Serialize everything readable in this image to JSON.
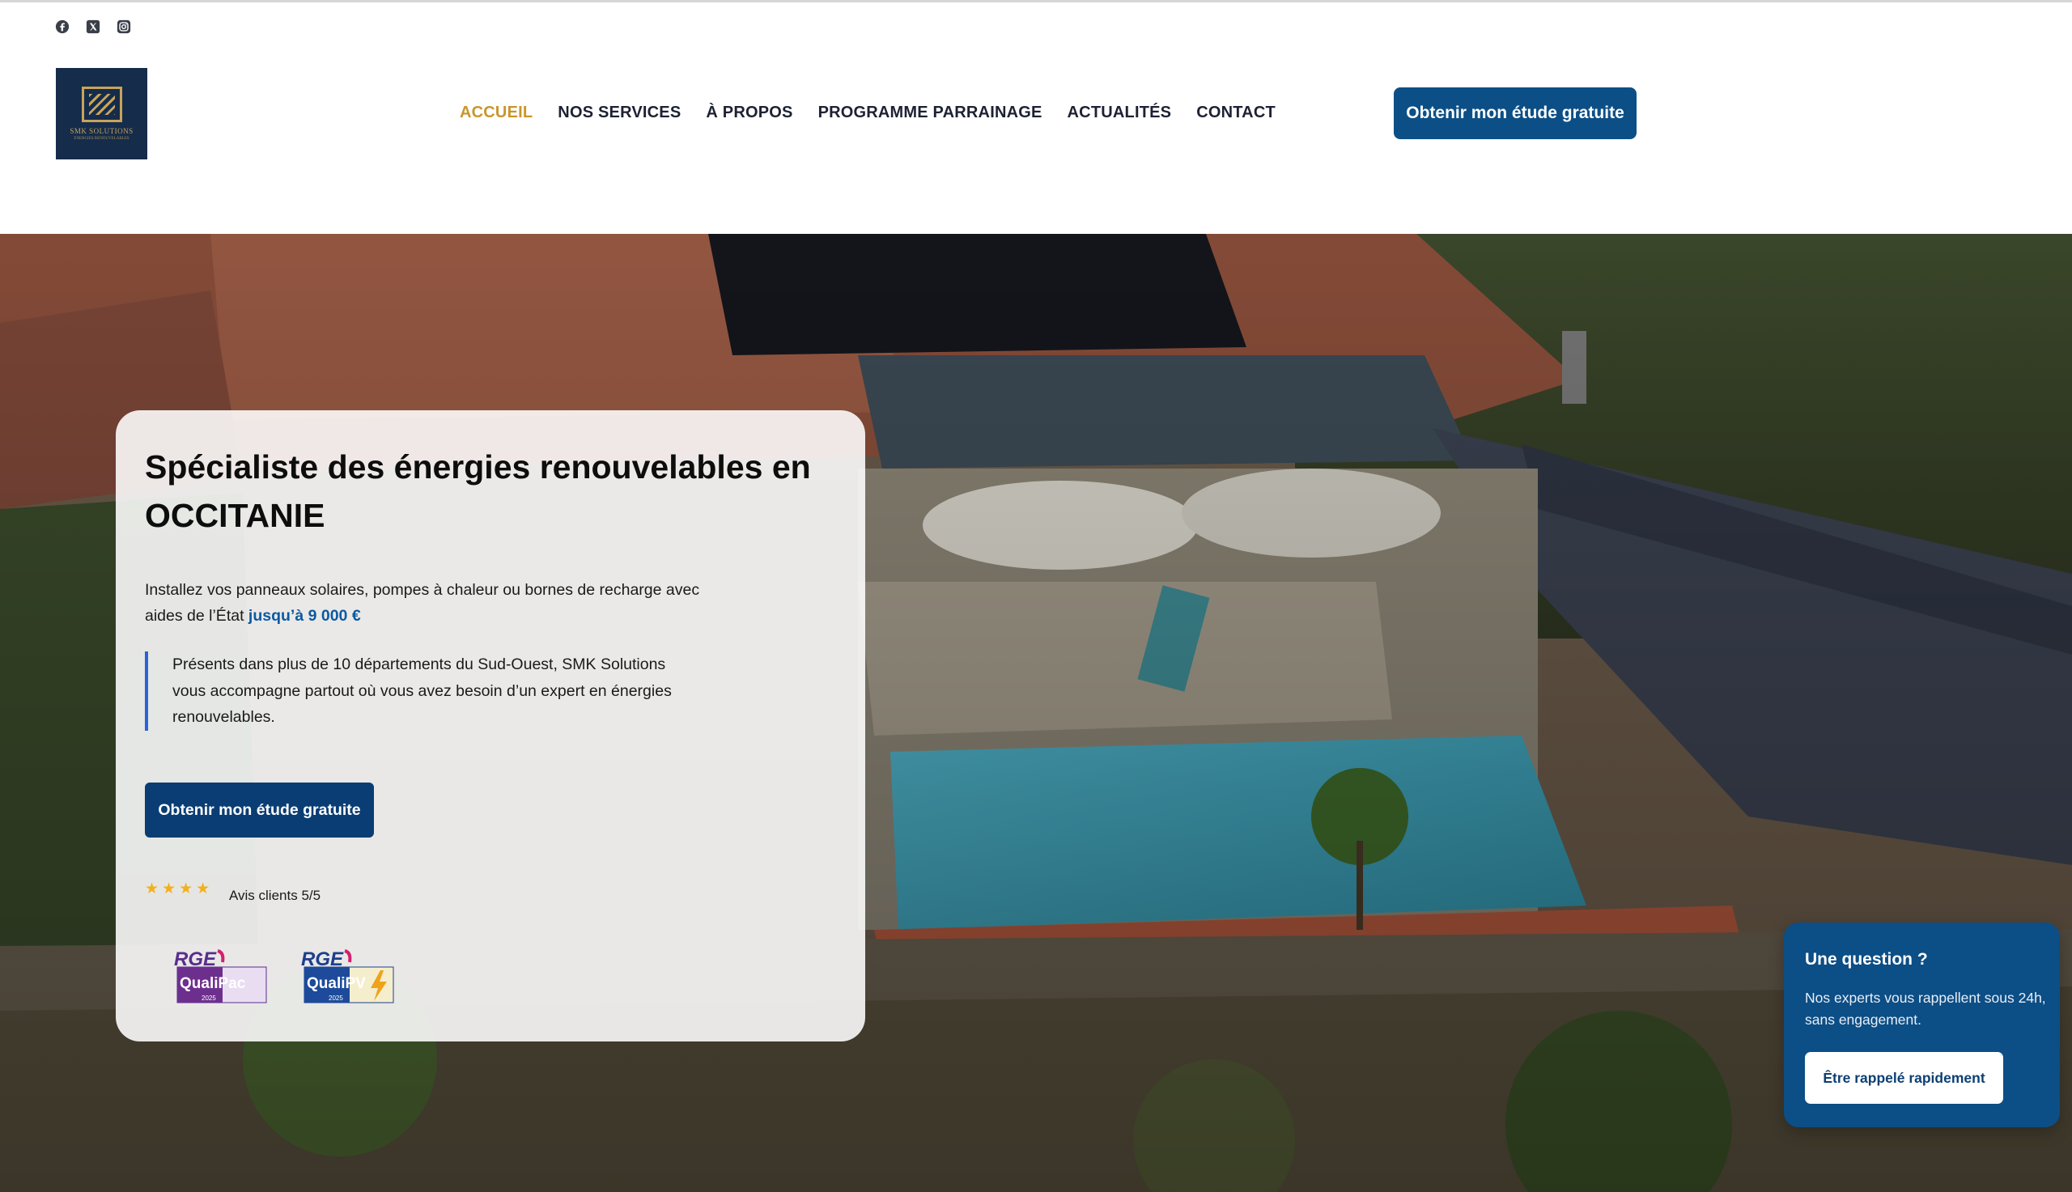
{
  "social": {
    "facebook_icon": "facebook-icon",
    "x_icon": "x-twitter-icon",
    "instagram_icon": "instagram-icon"
  },
  "logo": {
    "text": "SMK SOLUTIONS",
    "subtext": "ÉNERGIES RENOUVELABLES"
  },
  "nav": {
    "items": [
      {
        "label": "ACCUEIL",
        "active": true
      },
      {
        "label": "NOS SERVICES",
        "active": false
      },
      {
        "label": "À PROPOS",
        "active": false
      },
      {
        "label": "PROGRAMME PARRAINAGE",
        "active": false
      },
      {
        "label": "ACTUALITÉS",
        "active": false
      },
      {
        "label": "CONTACT",
        "active": false
      }
    ]
  },
  "header": {
    "cta_label": "Obtenir mon étude gratuite"
  },
  "hero": {
    "title": "Spécialiste des énergies renouvelables en OCCITANIE",
    "text_before": "Installez vos panneaux solaires, pompes à chaleur ou bornes de recharge avec aides de l’État ",
    "text_highlight": "jusqu’à 9 000 €",
    "quote": "Présents dans plus de 10 départements du Sud-Ouest, SMK Solutions vous accompagne partout où vous avez besoin d’un expert en énergies renouvelables.",
    "cta_label": "Obtenir mon étude gratuite",
    "stars": 4,
    "rating_label": "Avis clients 5/5",
    "badges": [
      {
        "line1": "RGE",
        "line2": "QualiPac",
        "year": "2025"
      },
      {
        "line1": "RGE",
        "line2": "QualiPV",
        "year": "2025"
      }
    ]
  },
  "popup": {
    "title": "Une question ?",
    "text": "Nos experts vous rappellent sous 24h, sans engagement.",
    "button_label": "Être rappelé rapidement"
  },
  "colors": {
    "brand_blue": "#0c4f86",
    "nav_active": "#c9962b",
    "highlight": "#0b5aa3",
    "star": "#f2b01e"
  }
}
